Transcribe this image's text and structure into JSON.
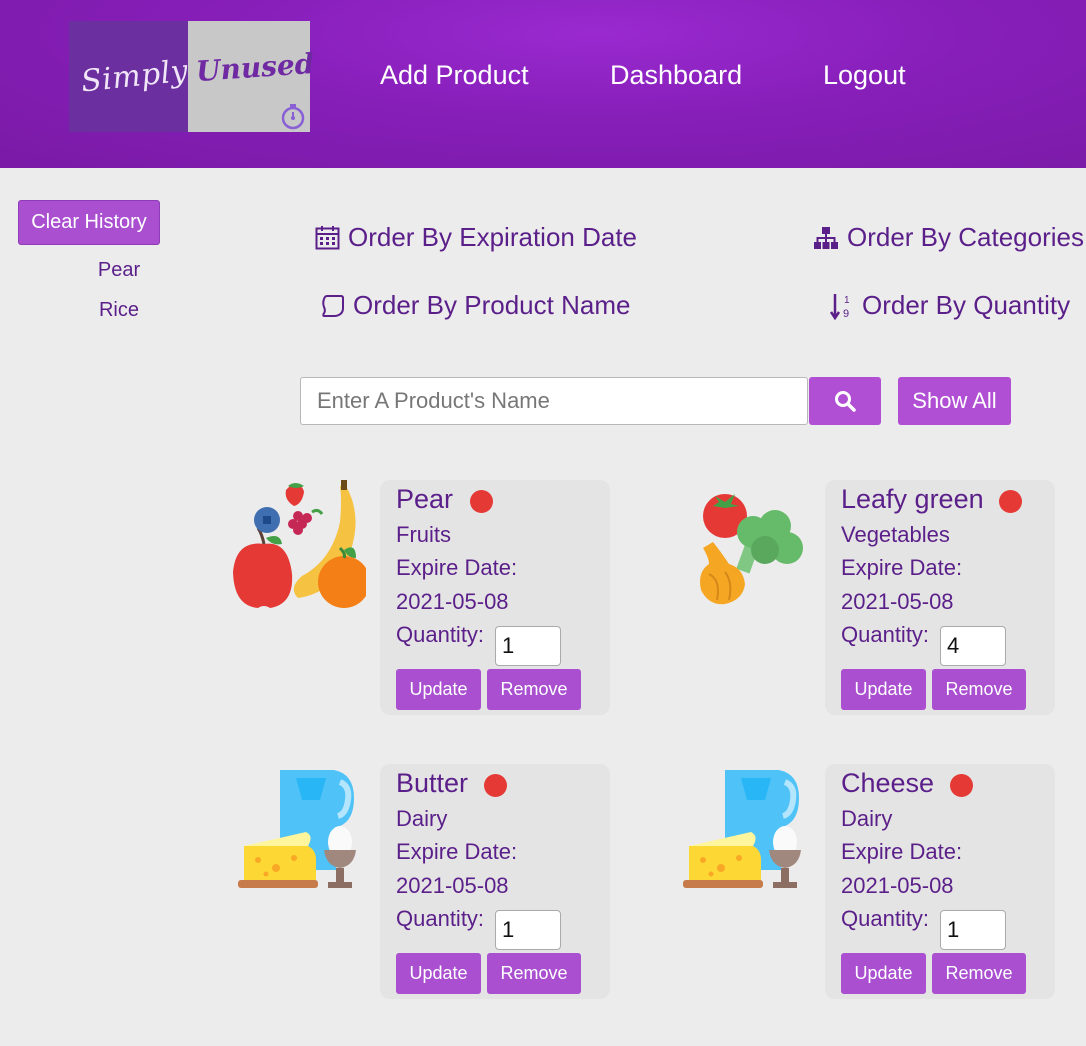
{
  "logo": {
    "word1": "Simply",
    "word2": "Unused"
  },
  "nav": {
    "add_product": "Add Product",
    "dashboard": "Dashboard",
    "logout": "Logout"
  },
  "sidebar": {
    "clear_history": "Clear History",
    "history": [
      "Pear",
      "Rice"
    ]
  },
  "order_by": {
    "expiration": "Order By Expiration Date",
    "categories": "Order By Categories",
    "product_name": "Order By Product Name",
    "quantity": "Order By Quantity"
  },
  "search": {
    "placeholder": "Enter A Product's Name",
    "value": "",
    "show_all": "Show All"
  },
  "colors": {
    "accent": "#a94fd0",
    "header": "#861eb8",
    "text": "#5b1f8a",
    "status_dot": "#e53935"
  },
  "products": [
    {
      "name": "Pear",
      "category": "Fruits",
      "expire_label": "Expire Date:",
      "expire_date": "2021-05-08",
      "quantity_label": "Quantity:",
      "quantity": "1",
      "update": "Update",
      "remove": "Remove",
      "image": "fruits-icon"
    },
    {
      "name": "Leafy green",
      "category": "Vegetables",
      "expire_label": "Expire Date:",
      "expire_date": "2021-05-08",
      "quantity_label": "Quantity:",
      "quantity": "4",
      "update": "Update",
      "remove": "Remove",
      "image": "vegetables-icon"
    },
    {
      "name": "Butter",
      "category": "Dairy",
      "expire_label": "Expire Date:",
      "expire_date": "2021-05-08",
      "quantity_label": "Quantity:",
      "quantity": "1",
      "update": "Update",
      "remove": "Remove",
      "image": "dairy-icon"
    },
    {
      "name": "Cheese",
      "category": "Dairy",
      "expire_label": "Expire Date:",
      "expire_date": "2021-05-08",
      "quantity_label": "Quantity:",
      "quantity": "1",
      "update": "Update",
      "remove": "Remove",
      "image": "dairy-icon"
    }
  ]
}
